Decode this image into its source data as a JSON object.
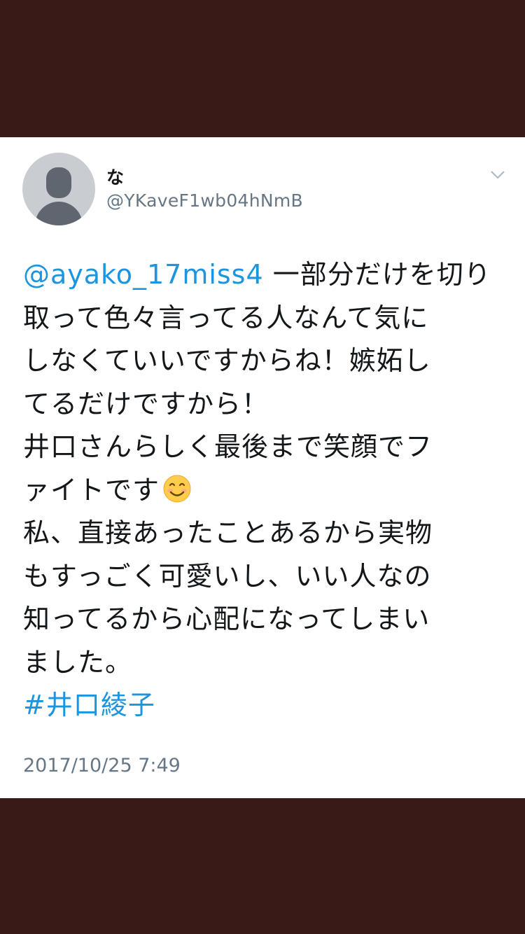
{
  "tweet": {
    "display_name": "な",
    "handle": "@YKaveF1wb04hNmB",
    "mention": "@ayako_17miss4",
    "lines": {
      "l1_rest": " 一部分だけを切り",
      "l2": "取って色々言ってる人なんて気に",
      "l3": "しなくていいですからね！嫉妬し",
      "l4": "てるだけですから！",
      "l5": "井口さんらしく最後まで笑顔でフ",
      "l6": "ァイトです",
      "l7": "私、直接あったことあるから実物",
      "l8": "もすっごく可愛いし、いい人なの",
      "l9": "知ってるから心配になってしまい",
      "l10": "ました。"
    },
    "emoji_icon": "smiling-face-emoji",
    "hashtag": "#井口綾子",
    "timestamp": "2017/10/25 7:49"
  },
  "colors": {
    "background": "#3a1a17",
    "card": "#ffffff",
    "link": "#1b95e0",
    "text": "#14171a",
    "muted": "#657786"
  }
}
